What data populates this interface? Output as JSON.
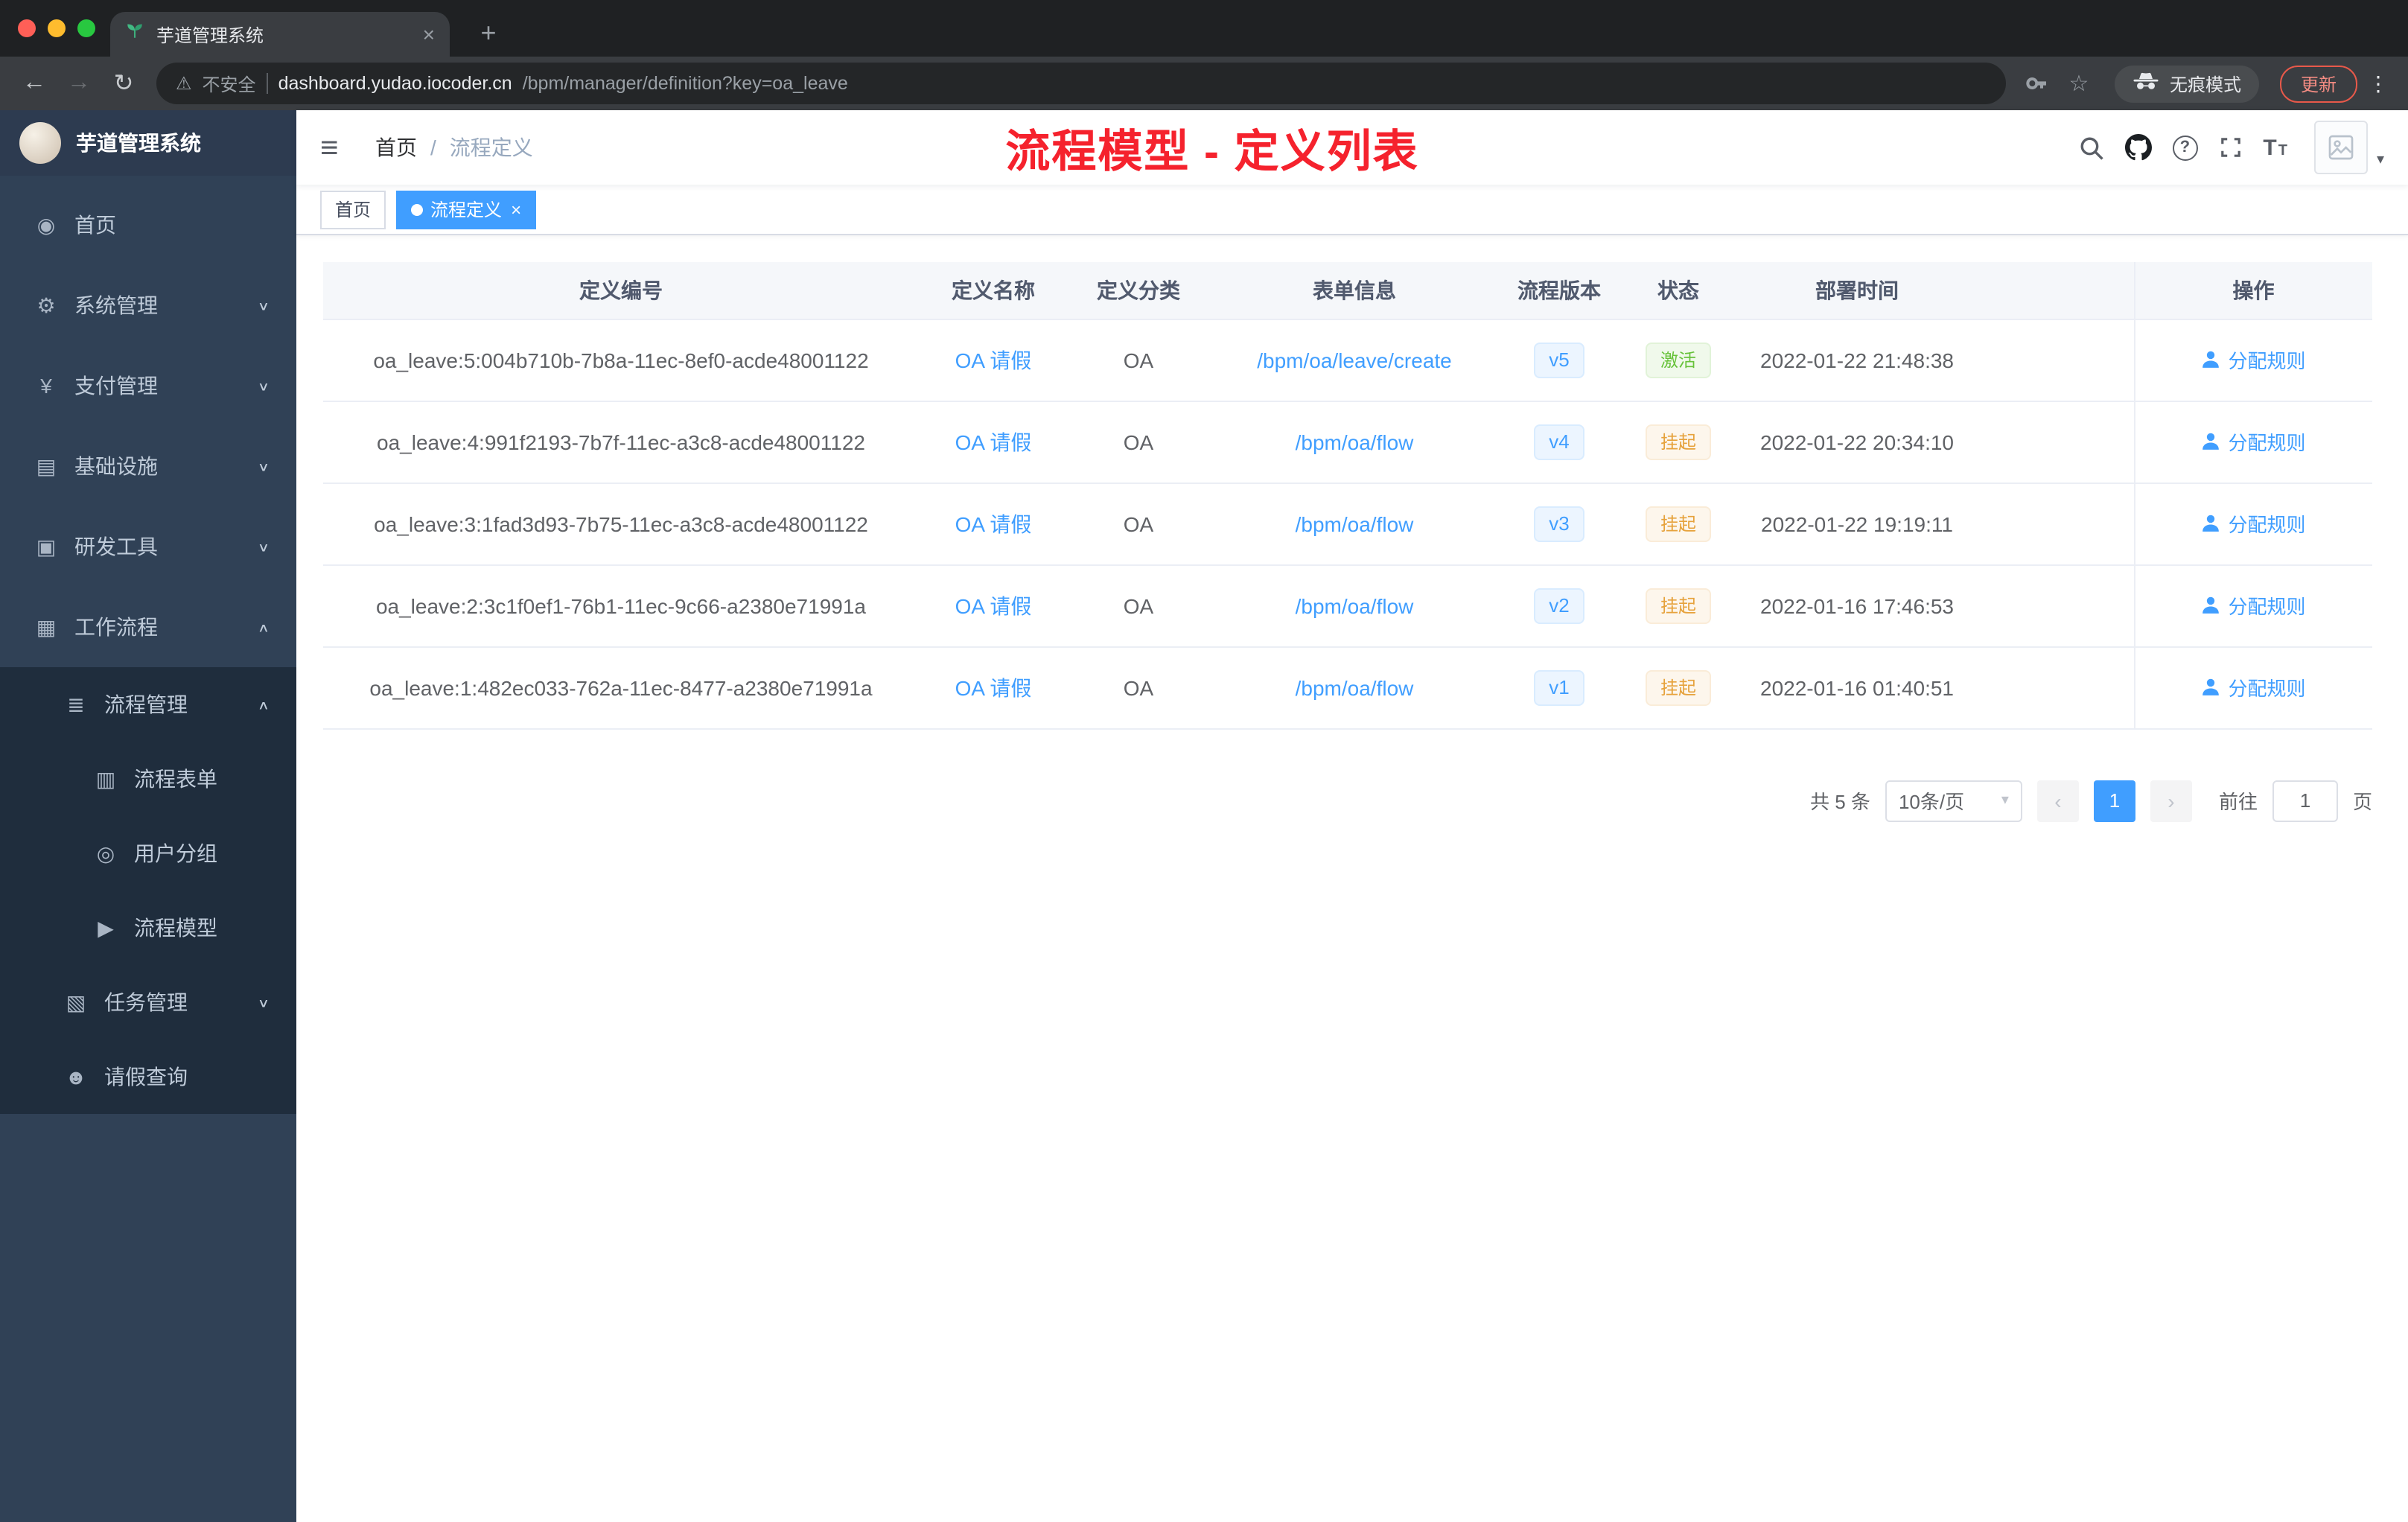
{
  "colors": {
    "accent": "#409eff",
    "annotation": "#f5222d",
    "success": "#67c23a",
    "warning": "#e6a23c",
    "sidebar_bg": "#304156"
  },
  "icons": {
    "hamburger": "≡",
    "back": "←",
    "forward": "→",
    "reload": "↻",
    "star": "☆",
    "kebab": "⋮",
    "close": "×",
    "new_tab": "+",
    "warning": "⚠",
    "chevron_down": "∨",
    "chevron_up": "∧",
    "caret": "▾",
    "question": "?",
    "size_big": "T",
    "size_small": "T",
    "prev": "‹",
    "next": "›"
  },
  "browser": {
    "tab_title": "芋道管理系统",
    "security_label": "不安全",
    "url_host": "dashboard.yudao.iocoder.cn",
    "url_path": "/bpm/manager/definition?key=oa_leave",
    "incognito_label": "无痕模式",
    "update_label": "更新"
  },
  "sidebar": {
    "logo_title": "芋道管理系统",
    "items": [
      {
        "glyph": "◉",
        "label": "首页"
      },
      {
        "glyph": "⚙",
        "label": "系统管理"
      },
      {
        "glyph": "¥",
        "label": "支付管理"
      },
      {
        "glyph": "▤",
        "label": "基础设施"
      },
      {
        "glyph": "▣",
        "label": "研发工具"
      },
      {
        "glyph": "▦",
        "label": "工作流程"
      },
      {
        "glyph": "≣",
        "label": "流程管理"
      },
      {
        "glyph": "▥",
        "label": "流程表单"
      },
      {
        "glyph": "◎",
        "label": "用户分组"
      },
      {
        "glyph": "▶",
        "label": "流程模型"
      },
      {
        "glyph": "▧",
        "label": "任务管理"
      },
      {
        "glyph": "☻",
        "label": "请假查询"
      }
    ]
  },
  "header": {
    "breadcrumb_home": "首页",
    "breadcrumb_sep": "/",
    "breadcrumb_current": "流程定义",
    "annotation": "流程模型 - 定义列表"
  },
  "tags": {
    "home": "首页",
    "active": "流程定义"
  },
  "table": {
    "columns": [
      "定义编号",
      "定义名称",
      "定义分类",
      "表单信息",
      "流程版本",
      "状态",
      "部署时间",
      "操作"
    ],
    "rows": [
      {
        "id": "oa_leave:5:004b710b-7b8a-11ec-8ef0-acde48001122",
        "name": "OA 请假",
        "category": "OA",
        "form": "/bpm/oa/leave/create",
        "version": "v5",
        "status": "激活",
        "time": "2022-01-22 21:48:38",
        "action": "分配规则"
      },
      {
        "id": "oa_leave:4:991f2193-7b7f-11ec-a3c8-acde48001122",
        "name": "OA 请假",
        "category": "OA",
        "form": "/bpm/oa/flow",
        "version": "v4",
        "status": "挂起",
        "time": "2022-01-22 20:34:10",
        "action": "分配规则"
      },
      {
        "id": "oa_leave:3:1fad3d93-7b75-11ec-a3c8-acde48001122",
        "name": "OA 请假",
        "category": "OA",
        "form": "/bpm/oa/flow",
        "version": "v3",
        "status": "挂起",
        "time": "2022-01-22 19:19:11",
        "action": "分配规则"
      },
      {
        "id": "oa_leave:2:3c1f0ef1-76b1-11ec-9c66-a2380e71991a",
        "name": "OA 请假",
        "category": "OA",
        "form": "/bpm/oa/flow",
        "version": "v2",
        "status": "挂起",
        "time": "2022-01-16 17:46:53",
        "action": "分配规则"
      },
      {
        "id": "oa_leave:1:482ec033-762a-11ec-8477-a2380e71991a",
        "name": "OA 请假",
        "category": "OA",
        "form": "/bpm/oa/flow",
        "version": "v1",
        "status": "挂起",
        "time": "2022-01-16 01:40:51",
        "action": "分配规则"
      }
    ]
  },
  "pagination": {
    "total": "共 5 条",
    "page_size": "10条/页",
    "current": "1",
    "goto_label": "前往",
    "goto_value": "1",
    "unit": "页"
  }
}
